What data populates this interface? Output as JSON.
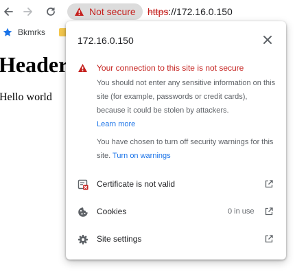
{
  "toolbar": {
    "security_chip_label": "Not secure",
    "url_scheme": "https",
    "url_rest": "://172.16.0.150"
  },
  "bookmarks": {
    "items": [
      {
        "label": "Bkmrks",
        "icon": "star-icon"
      },
      {
        "label": "",
        "icon": "folder-icon"
      }
    ]
  },
  "page": {
    "header": "Header",
    "text": "Hello world"
  },
  "popup": {
    "host": "172.16.0.150",
    "warning_title": "Your connection to this site is not secure",
    "warning_body": "You should not enter any sensitive information on this site (for example, passwords or credit cards), because it could be stolen by attackers.",
    "learn_more": "Learn more",
    "warnings_off_text": "You have chosen to turn off security warnings for this site.",
    "turn_on_warnings": "Turn on warnings",
    "rows": [
      {
        "label": "Certificate is not valid",
        "meta": "",
        "icon": "certificate-icon"
      },
      {
        "label": "Cookies",
        "meta": "0 in use",
        "icon": "cookie-icon"
      },
      {
        "label": "Site settings",
        "meta": "",
        "icon": "gear-icon"
      }
    ]
  },
  "colors": {
    "danger": "#c5221f",
    "link": "#1a73e8",
    "muted_text": "#5f6368",
    "chip_bg": "#dcdcdc"
  }
}
